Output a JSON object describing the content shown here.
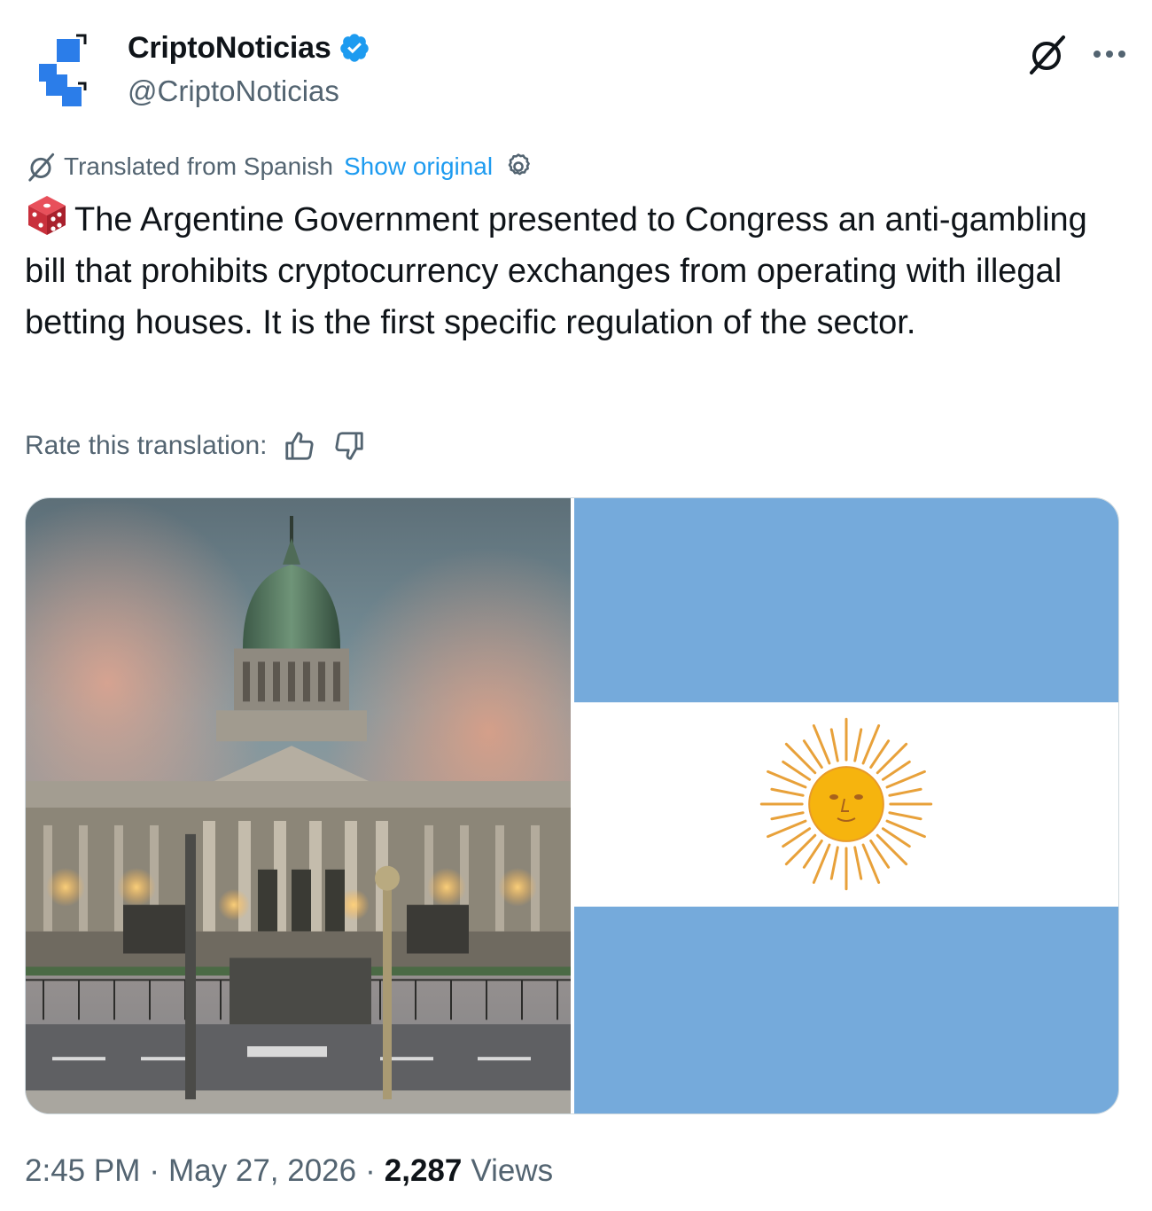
{
  "author": {
    "display_name": "CriptoNoticias",
    "handle": "@CriptoNoticias",
    "verified": true,
    "avatar_icon": "criptonoticias-logo-icon",
    "brand_color": "#2b7de9"
  },
  "actions": {
    "grok_icon": "grok-icon",
    "more_icon": "more-icon"
  },
  "translation": {
    "translated_label": "Translated from Spanish",
    "show_original": "Show original",
    "settings_icon": "gear-icon"
  },
  "tweet": {
    "emoji": "dice-emoji",
    "text": "The Argentine Government presented to Congress an anti-gambling bill that prohibits cryptocurrency exchanges from operating with illegal betting houses. It is the first specific regulation of the sector."
  },
  "rate": {
    "label": "Rate this translation:",
    "thumbs_up_icon": "thumbs-up-icon",
    "thumbs_down_icon": "thumbs-down-icon"
  },
  "media": {
    "images": [
      "congress-building-photo",
      "argentina-flag-image"
    ]
  },
  "meta": {
    "time": "2:45 PM",
    "separator": "·",
    "date": "May 27, 2026",
    "views_count": "2,287",
    "views_label": "Views"
  },
  "colors": {
    "link": "#1d9bf0",
    "secondary_text": "#536471",
    "flag_blue": "#75aadb",
    "sun": "#f6b40e"
  }
}
